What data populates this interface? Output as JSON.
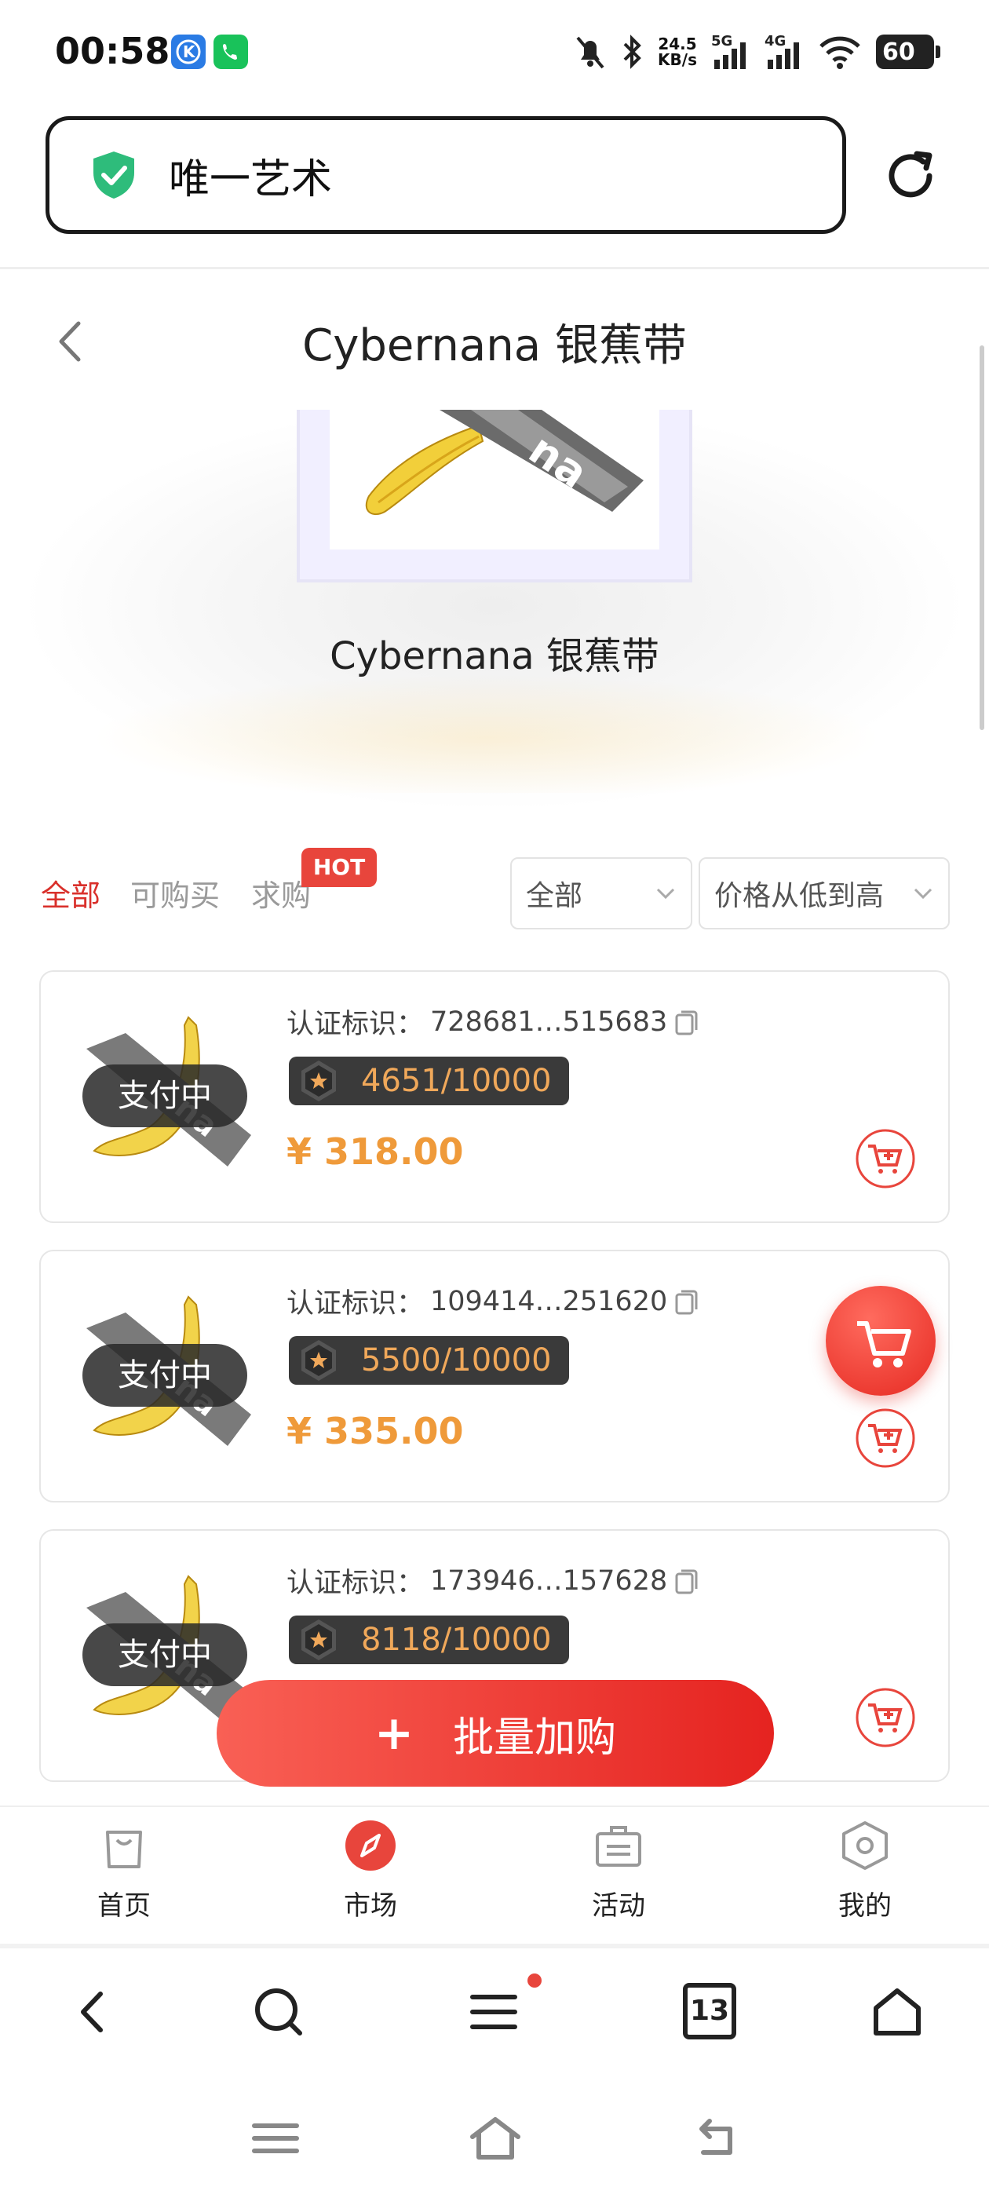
{
  "status_bar": {
    "time": "00:58",
    "net_speed_value": "24.5",
    "net_speed_unit": "KB/s",
    "signal1_label": "5G",
    "signal2_label": "4G",
    "battery": "60"
  },
  "url_bar": {
    "site_name": "唯一艺术"
  },
  "page": {
    "title": "Cybernana 银蕉带",
    "hero_name": "Cybernana 银蕉带"
  },
  "filters": {
    "tabs": [
      "全部",
      "可购买",
      "求购"
    ],
    "hot_badge": "HOT",
    "dropdown_status": "全部",
    "dropdown_sort": "价格从低到高"
  },
  "listings": [
    {
      "status": "支付中",
      "cert_label": "认证标识：",
      "cert_id": "728681…515683",
      "edition": "4651/10000",
      "price": "¥ 318.00"
    },
    {
      "status": "支付中",
      "cert_label": "认证标识：",
      "cert_id": "109414…251620",
      "edition": "5500/10000",
      "price": "¥ 335.00"
    },
    {
      "status": "支付中",
      "cert_label": "认证标识：",
      "cert_id": "173946…157628",
      "edition": "8118/10000",
      "price": ""
    }
  ],
  "batch_button": {
    "plus": "+",
    "label": "批量加购"
  },
  "bottom_nav": [
    {
      "label": "首页",
      "icon": "bag-icon"
    },
    {
      "label": "市场",
      "icon": "compass-icon"
    },
    {
      "label": "活动",
      "icon": "briefcase-icon"
    },
    {
      "label": "我的",
      "icon": "hexagon-icon"
    }
  ],
  "browser_toolbar": {
    "tab_count": "13"
  },
  "colors": {
    "accent_red": "#e8453c",
    "price_orange": "#ef9a3a",
    "edition_text": "#f0a85a"
  }
}
